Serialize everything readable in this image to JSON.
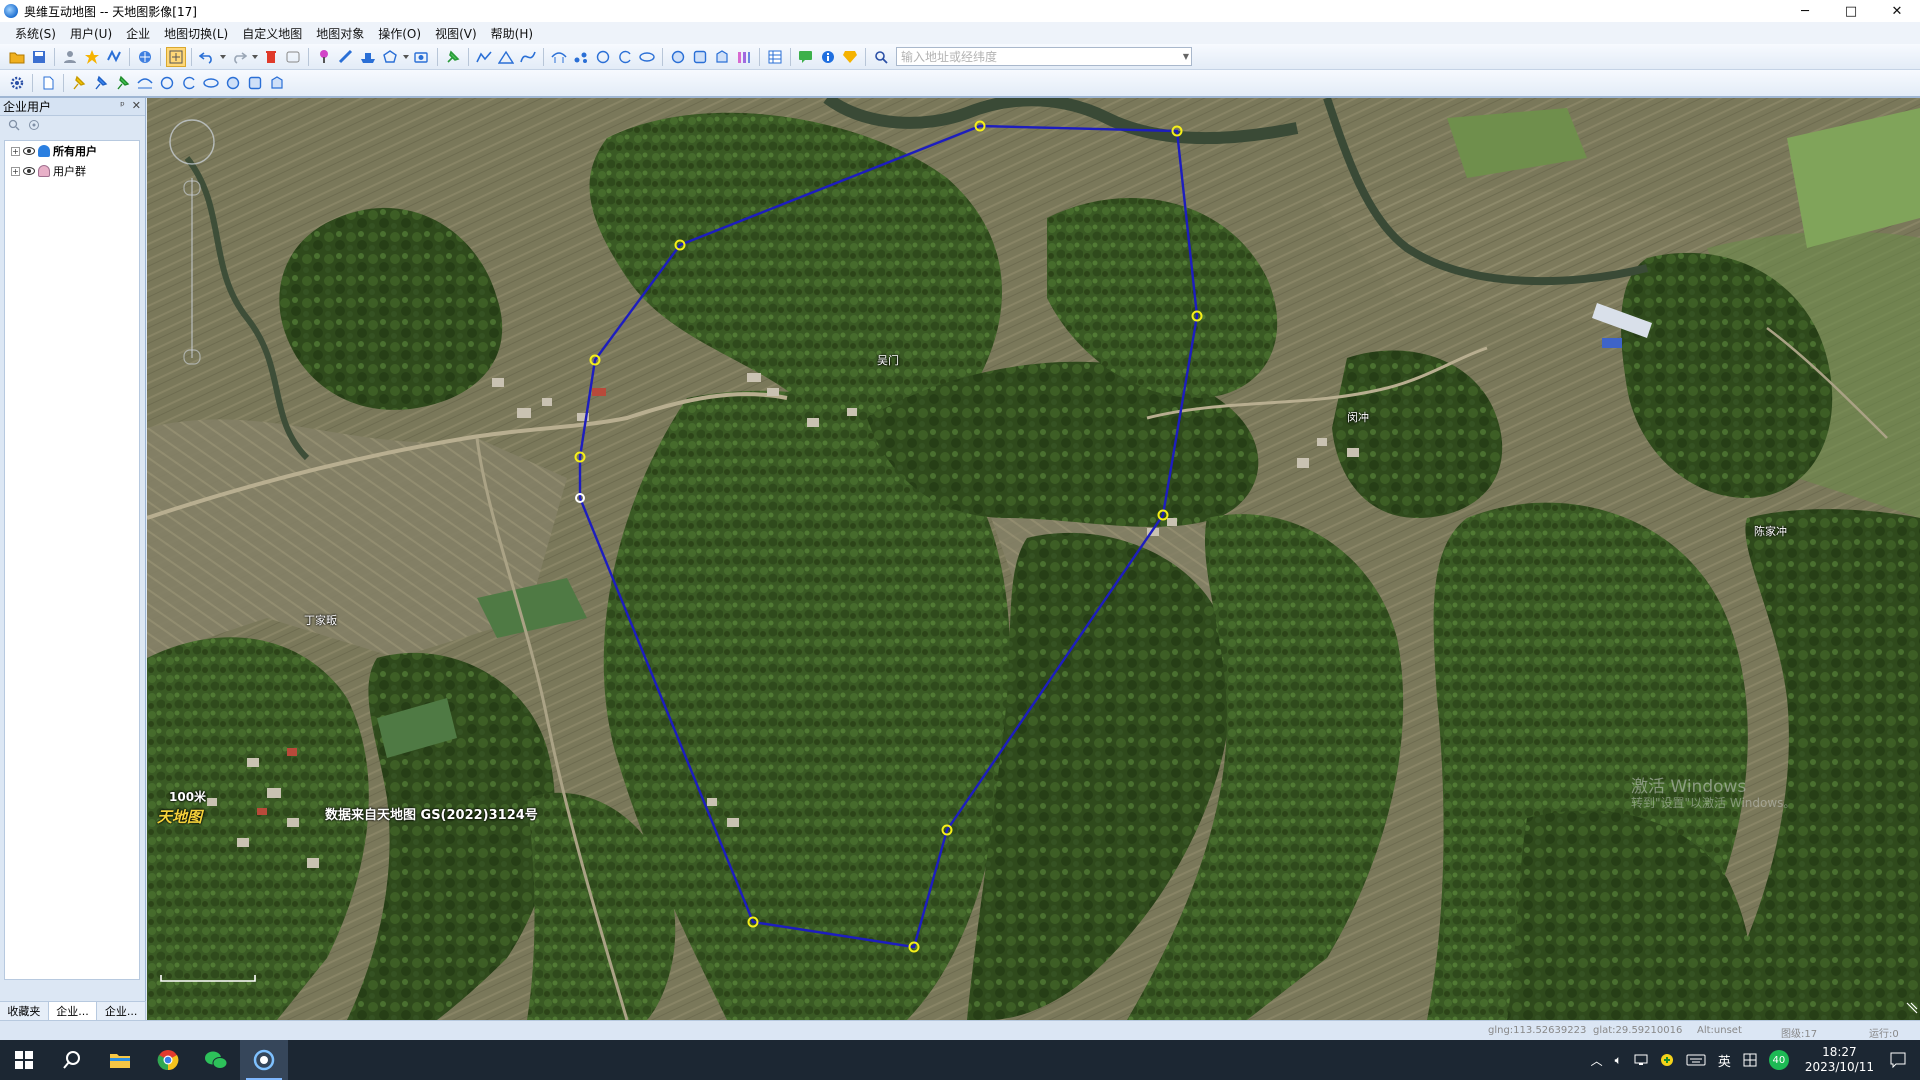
{
  "window": {
    "title": "奥维互动地图 -- 天地图影像[17]",
    "buttons": {
      "minimize": "─",
      "maximize": "□",
      "close": "✕"
    }
  },
  "menu": [
    {
      "label": "系统(S)"
    },
    {
      "label": "用户(U)"
    },
    {
      "label": "企业"
    },
    {
      "label": "地图切换(L)"
    },
    {
      "label": "自定义地图"
    },
    {
      "label": "地图对象"
    },
    {
      "label": "操作(O)"
    },
    {
      "label": "视图(V)"
    },
    {
      "label": "帮助(H)"
    }
  ],
  "search": {
    "placeholder": "输入地址或经纬度",
    "value": ""
  },
  "left_panel": {
    "title": "企业用户",
    "tree": [
      {
        "label": "所有用户",
        "bold": true
      },
      {
        "label": "用户群",
        "bold": false
      }
    ],
    "tabs": [
      "收藏夹",
      "企业...",
      "企业..."
    ]
  },
  "map": {
    "place_labels": [
      {
        "id": "wumen",
        "text": "吴门"
      },
      {
        "id": "minchong",
        "text": "闵冲"
      },
      {
        "id": "chenjiachong",
        "text": "陈家冲"
      },
      {
        "id": "dingjiafan",
        "text": "丁家畈"
      }
    ],
    "scale_label": "100米",
    "brand_logo": "天地图",
    "attribution": "数据来自天地图 GS(2022)3124号",
    "polygon_color": "#1d1dbe",
    "vertex_color": "#f5ef1a"
  },
  "status": {
    "lng": "glng:113.52639223",
    "lat": "glat:29.59210016",
    "alt": "Alt:unset",
    "level": "图级:17",
    "run": "运行:0"
  },
  "watermark": {
    "line1": "激活 Windows",
    "line2": "转到\"设置\"以激活 Windows。"
  },
  "taskbar": {
    "ime": "英",
    "badge": "40",
    "time": "18:27",
    "date": "2023/10/11"
  }
}
